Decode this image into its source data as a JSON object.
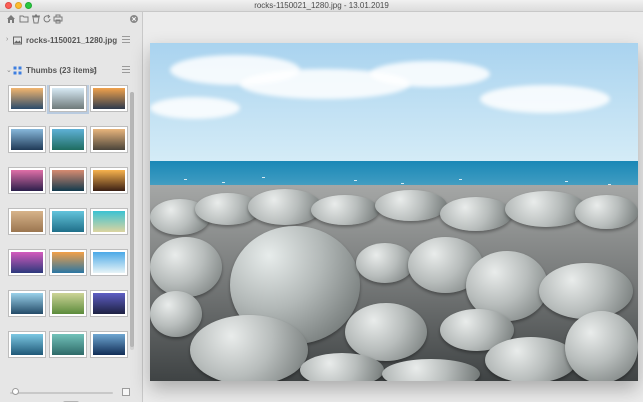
{
  "window": {
    "title": "rocks-1150021_1280.jpg - 13.01.2019"
  },
  "toolbar": {
    "icons": [
      "home-icon",
      "folder-icon",
      "trash-icon",
      "refresh-icon",
      "print-icon",
      "close-icon"
    ]
  },
  "sidebar": {
    "file_section": {
      "label": "rocks-1150021_1280.jpg",
      "icon": "image-icon"
    },
    "thumbs_section": {
      "label": "Thumbs (23 items)",
      "icon": "grid-icon",
      "action_icon": "shuffle-icon"
    },
    "thumbnails": [
      {
        "name": "sunset-sea",
        "c1": "#f3b66f",
        "c2": "#2b4b6b",
        "selected": false
      },
      {
        "name": "rocks-beach",
        "c1": "#d8eaf5",
        "c2": "#6f7a7a",
        "selected": true
      },
      {
        "name": "coast-sunset",
        "c1": "#f1a24c",
        "c2": "#2d3a4d",
        "selected": false
      },
      {
        "name": "ocean-dusk",
        "c1": "#87b8db",
        "c2": "#203a57",
        "selected": false
      },
      {
        "name": "island-palm",
        "c1": "#5fb1d7",
        "c2": "#1e6c60",
        "selected": false
      },
      {
        "name": "rocky-coast",
        "c1": "#e8b57c",
        "c2": "#4a443a",
        "selected": false
      },
      {
        "name": "pink-sky",
        "c1": "#e06fa8",
        "c2": "#2b1f4b",
        "selected": false
      },
      {
        "name": "waves-dusk",
        "c1": "#d78b71",
        "c2": "#123a4d",
        "selected": false
      },
      {
        "name": "palm-sunset",
        "c1": "#f8b24d",
        "c2": "#3b1f14",
        "selected": false
      },
      {
        "name": "sand-texture",
        "c1": "#d7b38a",
        "c2": "#9b7650",
        "selected": false
      },
      {
        "name": "turquoise-wave",
        "c1": "#63c4dc",
        "c2": "#1f6f89",
        "selected": false
      },
      {
        "name": "tropic-water",
        "c1": "#3bc2d2",
        "c2": "#dcd4a0",
        "selected": false
      },
      {
        "name": "purple-shore",
        "c1": "#d45bbd",
        "c2": "#2c397c",
        "selected": false
      },
      {
        "name": "aerial-sand",
        "c1": "#f2a048",
        "c2": "#2b76a3",
        "selected": false
      },
      {
        "name": "blue-beach",
        "c1": "#4ba9e7",
        "c2": "#e7f4f7",
        "selected": false
      },
      {
        "name": "surf-waves",
        "c1": "#9ad1ea",
        "c2": "#244b68",
        "selected": false
      },
      {
        "name": "green-bay",
        "c1": "#cdd497",
        "c2": "#5c8b3c",
        "selected": false
      },
      {
        "name": "night-dock",
        "c1": "#5e5ec4",
        "c2": "#1d2142",
        "selected": false
      },
      {
        "name": "sea-foam",
        "c1": "#7cc8e3",
        "c2": "#1f5877",
        "selected": false
      },
      {
        "name": "cove-view",
        "c1": "#72c2ba",
        "c2": "#2e6a68",
        "selected": false
      },
      {
        "name": "deep-blue",
        "c1": "#6fa7d2",
        "c2": "#112d56",
        "selected": false
      }
    ]
  },
  "bottom_bar": {
    "zoom_level": 0.05,
    "icons": [
      "zoom-slider",
      "fit-icon"
    ]
  },
  "viewer": {
    "image_name": "beach-pebbles"
  }
}
